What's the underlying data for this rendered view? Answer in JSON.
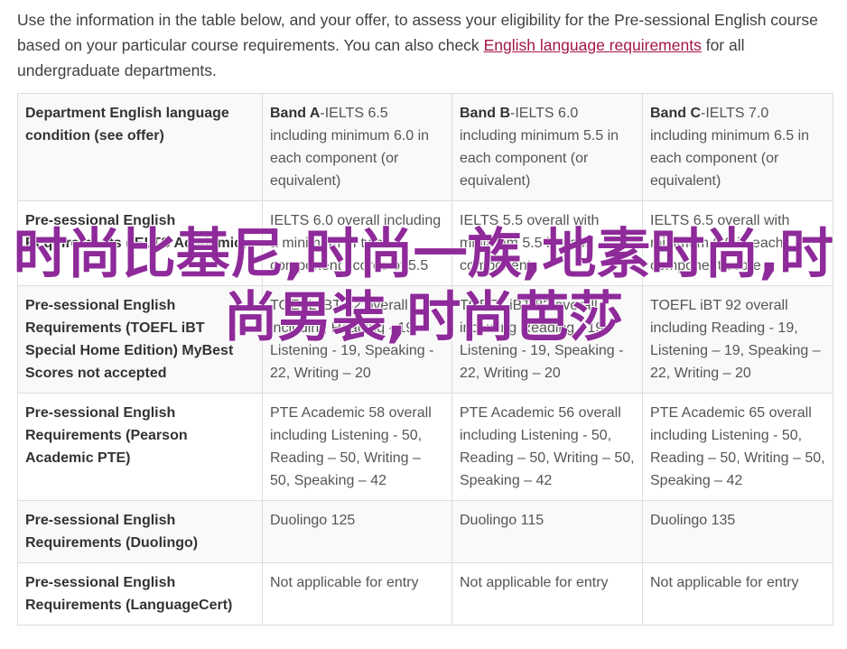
{
  "intro": {
    "text_before": "Use the information in the table below, and your offer, to assess your eligibility for the Pre-sessional English course based on your particular course requirements. You can also check ",
    "link": "English language requirements",
    "text_after": " for all undergraduate departments."
  },
  "table": {
    "rows": [
      {
        "head": "Department English language condition (see offer)",
        "cells": [
          {
            "band": "Band A",
            "text": "-IELTS 6.5 including minimum 6.0 in each component (or equivalent)"
          },
          {
            "band": "Band B",
            "text": "-IELTS 6.0 including minimum 5.5 in each component (or equivalent)"
          },
          {
            "band": "Band C",
            "text": "-IELTS 7.0 including minimum 6.5 in each component (or equivalent)"
          }
        ]
      },
      {
        "head": "Pre-sessional English Requirements (IELTS Academic)",
        "cells": [
          {
            "band": "",
            "text": "IELTS 6.0 overall including a minimum of two component scores of 5.5"
          },
          {
            "band": "",
            "text": "IELTS 5.5 overall with minimum 5.5 in each component"
          },
          {
            "band": "",
            "text": "IELTS 6.5 overall with minimum 6.0 in each component score"
          }
        ]
      },
      {
        "head": "Pre-sessional English Requirements (TOEFL iBT Special Home Edition) MyBest Scores not accepted",
        "cells": [
          {
            "band": "",
            "text": "TOEFL iBT 82 overall including Reading - 19, Listening - 19, Speaking - 22, Writing – 20"
          },
          {
            "band": "",
            "text": "TOEFL iBT 82 overall including Reading - 19, Listening - 19, Speaking - 22, Writing – 20"
          },
          {
            "band": "",
            "text": "TOEFL iBT 92 overall including Reading - 19, Listening – 19, Speaking – 22, Writing – 20"
          }
        ]
      },
      {
        "head": "Pre-sessional English Requirements (Pearson Academic PTE)",
        "cells": [
          {
            "band": "",
            "text": "PTE Academic 58 overall including Listening - 50, Reading – 50, Writing – 50, Speaking – 42"
          },
          {
            "band": "",
            "text": "PTE Academic 56 overall including Listening - 50, Reading – 50, Writing – 50, Speaking – 42"
          },
          {
            "band": "",
            "text": "PTE Academic 65 overall including Listening - 50, Reading – 50, Writing – 50, Speaking – 42"
          }
        ]
      },
      {
        "head": "Pre-sessional English Requirements (Duolingo)",
        "cells": [
          {
            "band": "",
            "text": "Duolingo 125"
          },
          {
            "band": "",
            "text": "Duolingo 115"
          },
          {
            "band": "",
            "text": "Duolingo 135"
          }
        ]
      },
      {
        "head": "Pre-sessional English Requirements (LanguageCert)",
        "cells": [
          {
            "band": "",
            "text": "Not applicable for entry"
          },
          {
            "band": "",
            "text": "Not applicable for entry"
          },
          {
            "band": "",
            "text": "Not applicable for entry"
          }
        ]
      }
    ]
  },
  "watermark": "时尚比基尼,时尚一族,地素时尚,时尚男装,时尚芭莎",
  "colors": {
    "link": "#a3154a",
    "watermark": "#8e2a99",
    "border": "#dddddd"
  }
}
